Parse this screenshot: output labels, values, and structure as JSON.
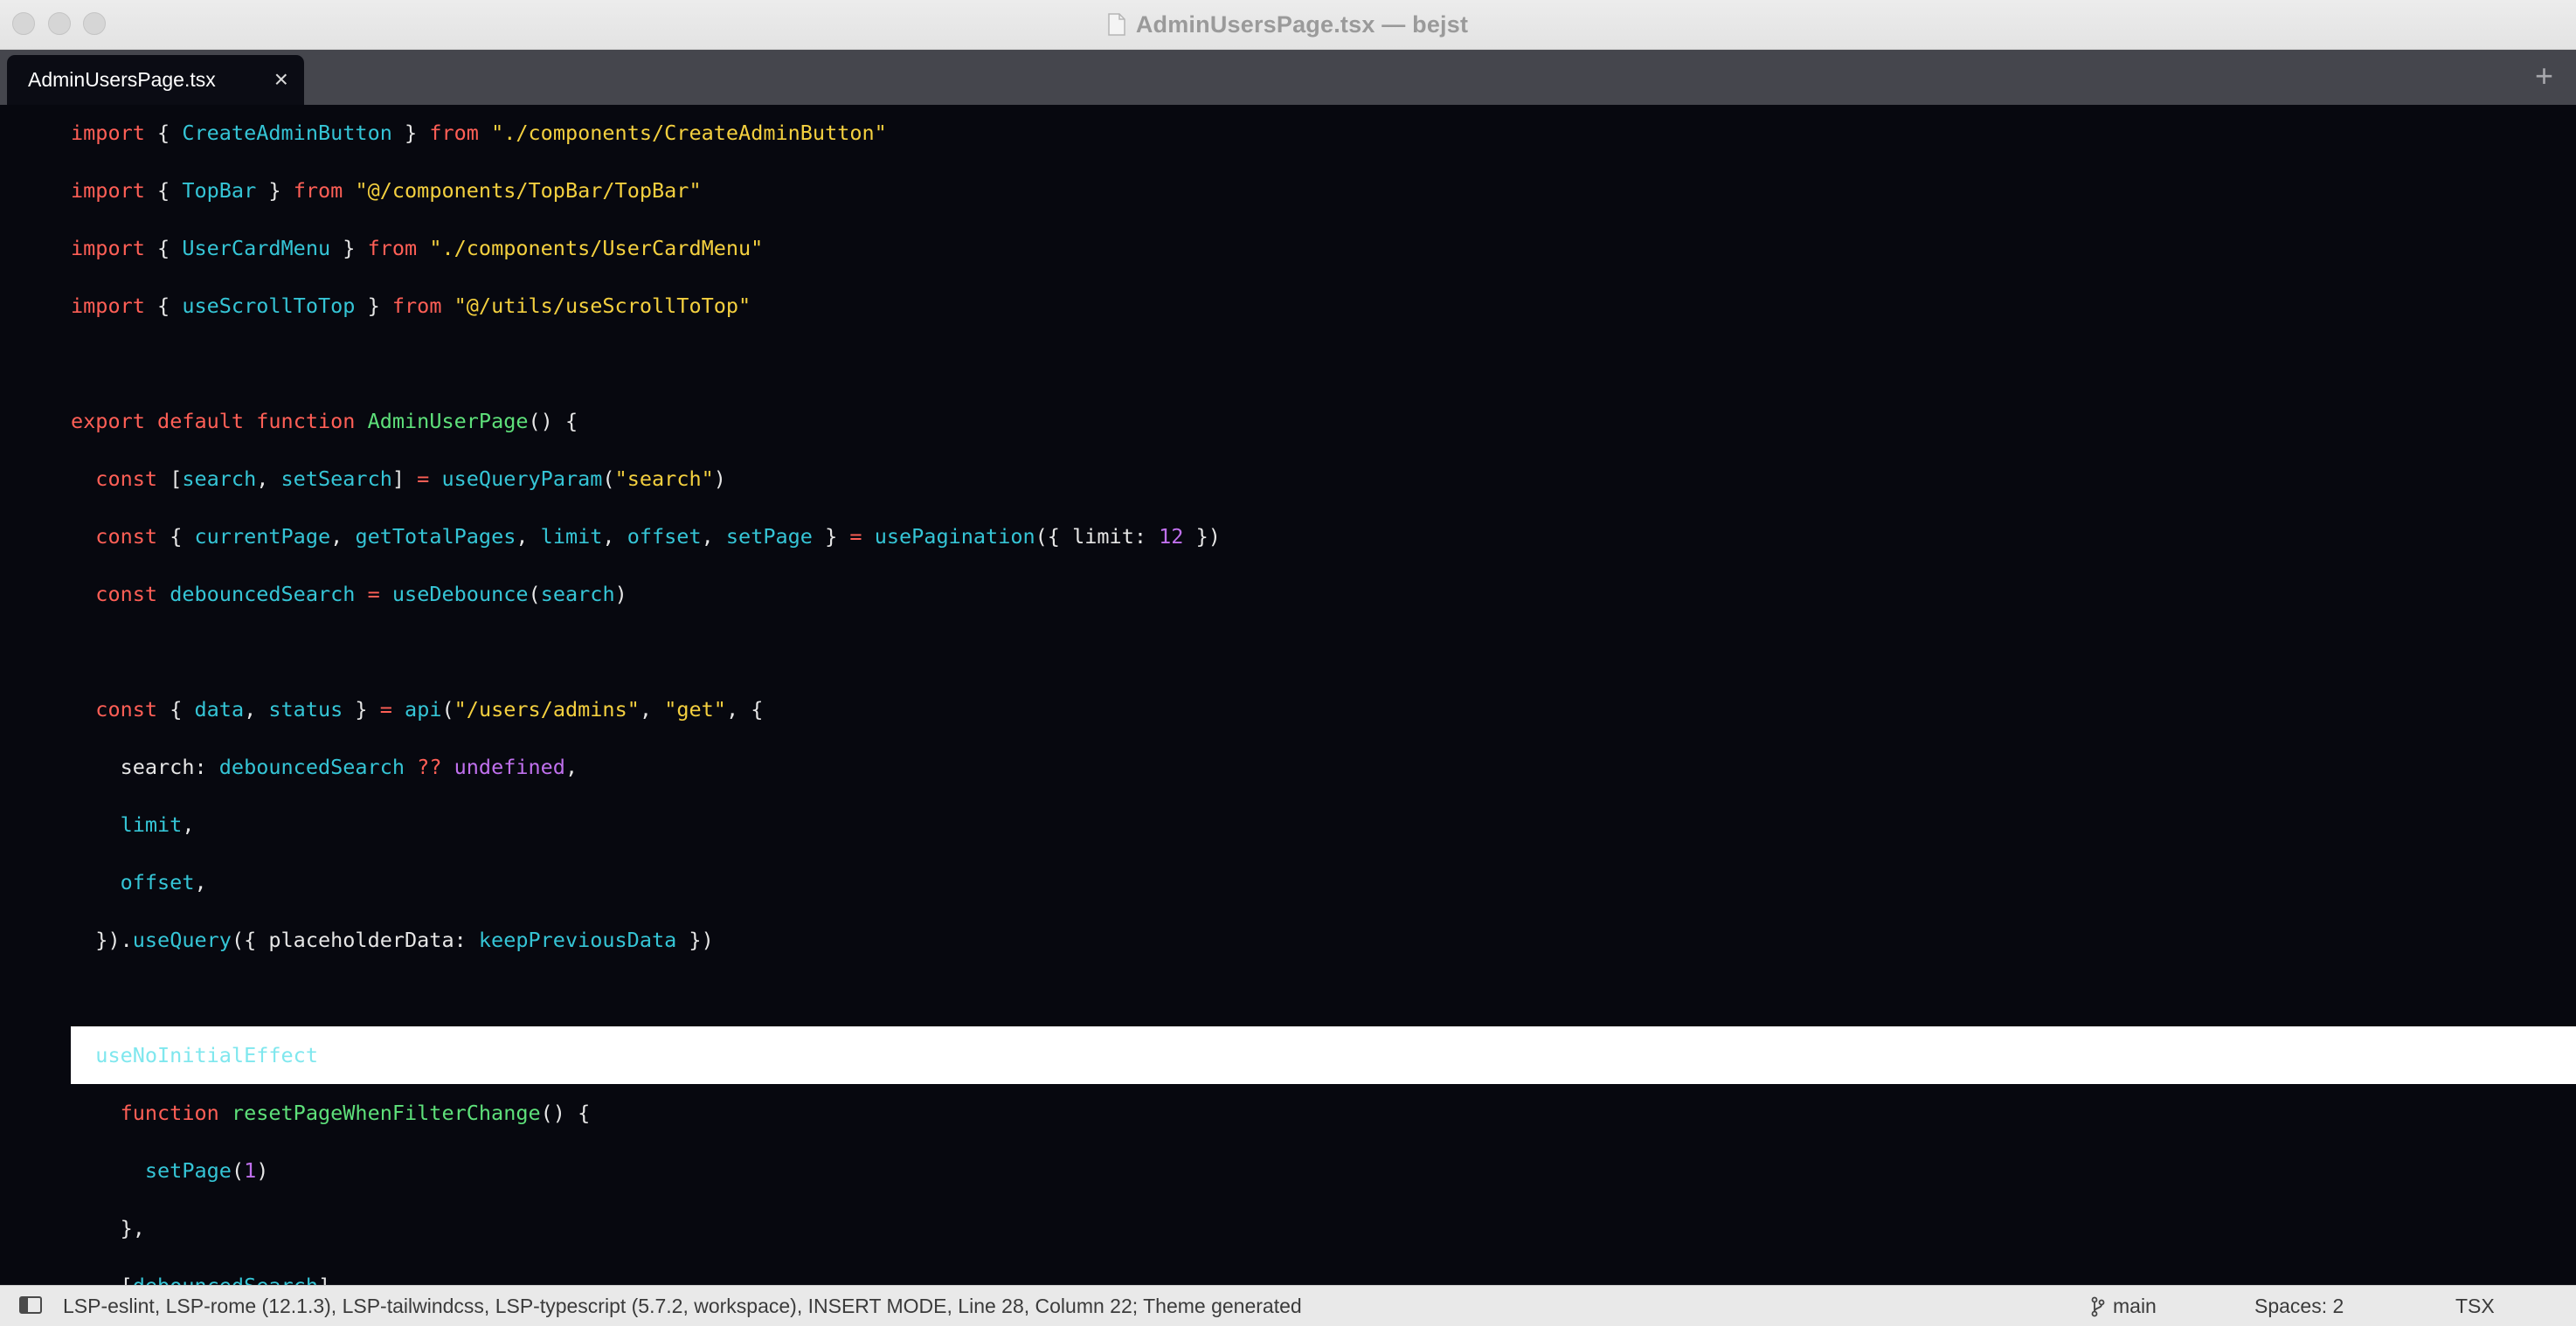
{
  "window": {
    "title": "AdminUsersPage.tsx — bejst"
  },
  "tabs": [
    {
      "label": "AdminUsersPage.tsx",
      "close": "×",
      "active": true
    }
  ],
  "new_tab": "+",
  "code_lines": [
    [
      [
        "k",
        "import"
      ],
      [
        "p",
        " { "
      ],
      [
        "c",
        "CreateAdminButton"
      ],
      [
        "p",
        " } "
      ],
      [
        "k",
        "from"
      ],
      [
        "p",
        " "
      ],
      [
        "s",
        "\"./components/CreateAdminButton\""
      ]
    ],
    [
      [
        "k",
        "import"
      ],
      [
        "p",
        " { "
      ],
      [
        "c",
        "TopBar"
      ],
      [
        "p",
        " } "
      ],
      [
        "k",
        "from"
      ],
      [
        "p",
        " "
      ],
      [
        "s",
        "\"@/components/TopBar/TopBar\""
      ]
    ],
    [
      [
        "k",
        "import"
      ],
      [
        "p",
        " { "
      ],
      [
        "c",
        "UserCardMenu"
      ],
      [
        "p",
        " } "
      ],
      [
        "k",
        "from"
      ],
      [
        "p",
        " "
      ],
      [
        "s",
        "\"./components/UserCardMenu\""
      ]
    ],
    [
      [
        "k",
        "import"
      ],
      [
        "p",
        " { "
      ],
      [
        "c",
        "useScrollToTop"
      ],
      [
        "p",
        " } "
      ],
      [
        "k",
        "from"
      ],
      [
        "p",
        " "
      ],
      [
        "s",
        "\"@/utils/useScrollToTop\""
      ]
    ],
    [],
    [
      [
        "k",
        "export"
      ],
      [
        "p",
        " "
      ],
      [
        "k",
        "default"
      ],
      [
        "p",
        " "
      ],
      [
        "k",
        "function"
      ],
      [
        "p",
        " "
      ],
      [
        "f",
        "AdminUserPage"
      ],
      [
        "p",
        "() {"
      ]
    ],
    [
      [
        "p",
        "  "
      ],
      [
        "k",
        "const"
      ],
      [
        "p",
        " ["
      ],
      [
        "c",
        "search"
      ],
      [
        "p",
        ", "
      ],
      [
        "c",
        "setSearch"
      ],
      [
        "p",
        "] "
      ],
      [
        "op",
        "="
      ],
      [
        "p",
        " "
      ],
      [
        "c",
        "useQueryParam"
      ],
      [
        "p",
        "("
      ],
      [
        "s",
        "\"search\""
      ],
      [
        "p",
        ")"
      ]
    ],
    [
      [
        "p",
        "  "
      ],
      [
        "k",
        "const"
      ],
      [
        "p",
        " { "
      ],
      [
        "c",
        "currentPage"
      ],
      [
        "p",
        ", "
      ],
      [
        "c",
        "getTotalPages"
      ],
      [
        "p",
        ", "
      ],
      [
        "c",
        "limit"
      ],
      [
        "p",
        ", "
      ],
      [
        "c",
        "offset"
      ],
      [
        "p",
        ", "
      ],
      [
        "c",
        "setPage"
      ],
      [
        "p",
        " } "
      ],
      [
        "op",
        "="
      ],
      [
        "p",
        " "
      ],
      [
        "c",
        "usePagination"
      ],
      [
        "p",
        "({ limit: "
      ],
      [
        "n",
        "12"
      ],
      [
        "p",
        " })"
      ]
    ],
    [
      [
        "p",
        "  "
      ],
      [
        "k",
        "const"
      ],
      [
        "p",
        " "
      ],
      [
        "c",
        "debouncedSearch"
      ],
      [
        "p",
        " "
      ],
      [
        "op",
        "="
      ],
      [
        "p",
        " "
      ],
      [
        "c",
        "useDebounce"
      ],
      [
        "p",
        "("
      ],
      [
        "c",
        "search"
      ],
      [
        "p",
        ")"
      ]
    ],
    [],
    [
      [
        "p",
        "  "
      ],
      [
        "k",
        "const"
      ],
      [
        "p",
        " { "
      ],
      [
        "c",
        "data"
      ],
      [
        "p",
        ", "
      ],
      [
        "c",
        "status"
      ],
      [
        "p",
        " } "
      ],
      [
        "op",
        "="
      ],
      [
        "p",
        " "
      ],
      [
        "c",
        "api"
      ],
      [
        "p",
        "("
      ],
      [
        "s",
        "\"/users/admins\""
      ],
      [
        "p",
        ", "
      ],
      [
        "s",
        "\"get\""
      ],
      [
        "p",
        ", {"
      ]
    ],
    [
      [
        "p",
        "    search: "
      ],
      [
        "c",
        "debouncedSearch"
      ],
      [
        "p",
        " "
      ],
      [
        "op",
        "??"
      ],
      [
        "p",
        " "
      ],
      [
        "n",
        "undefined"
      ],
      [
        "p",
        ","
      ]
    ],
    [
      [
        "p",
        "    "
      ],
      [
        "c",
        "limit"
      ],
      [
        "p",
        ","
      ]
    ],
    [
      [
        "p",
        "    "
      ],
      [
        "c",
        "offset"
      ],
      [
        "p",
        ","
      ]
    ],
    [
      [
        "p",
        "  })."
      ],
      [
        "c",
        "useQuery"
      ],
      [
        "p",
        "({ placeholderData: "
      ],
      [
        "c",
        "keepPreviousData"
      ],
      [
        "p",
        " })"
      ]
    ],
    [],
    [
      [
        "p",
        "  "
      ],
      [
        "cur",
        "useNoInitialEffect"
      ]
    ],
    [
      [
        "p",
        "    "
      ],
      [
        "k",
        "function"
      ],
      [
        "p",
        " "
      ],
      [
        "f",
        "resetPageWhenFilterChange"
      ],
      [
        "p",
        "() {"
      ]
    ],
    [
      [
        "p",
        "      "
      ],
      [
        "c",
        "setPage"
      ],
      [
        "p",
        "("
      ],
      [
        "n",
        "1"
      ],
      [
        "p",
        ")"
      ]
    ],
    [
      [
        "p",
        "    },"
      ]
    ],
    [
      [
        "p",
        "    ["
      ],
      [
        "c",
        "debouncedSearch"
      ],
      [
        "p",
        "]"
      ]
    ]
  ],
  "highlighted_line_index": 16,
  "statusbar": {
    "text": "LSP-eslint, LSP-rome (12.1.3), LSP-tailwindcss, LSP-typescript (5.7.2, workspace), INSERT MODE, Line 28, Column 22; Theme generated",
    "branch": "main",
    "spaces": "Spaces: 2",
    "syntax": "TSX"
  }
}
